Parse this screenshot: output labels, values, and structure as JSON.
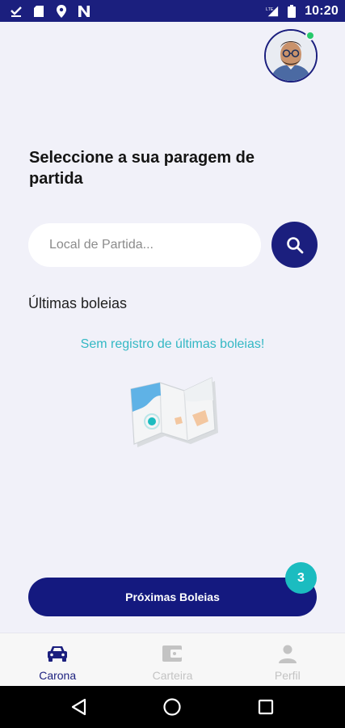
{
  "status_bar": {
    "time": "10:20",
    "icons_left": [
      "check-download-icon",
      "sd-card-icon",
      "location-pin-icon",
      "n-app-icon"
    ],
    "icons_right": [
      "signal-lte-icon",
      "battery-icon"
    ]
  },
  "profile": {
    "avatar_icon": "user-avatar",
    "online": true,
    "online_color": "#27c96b"
  },
  "main": {
    "heading": "Seleccione a sua paragem de partida",
    "search": {
      "placeholder": "Local de Partida...",
      "value": "",
      "button_icon": "search-icon"
    },
    "recent_title": "Últimas boleias",
    "empty_message": "Sem registro de últimas boleias!",
    "illustration_icon": "folded-map-icon"
  },
  "action": {
    "button_label": "Próximas Boleias",
    "badge_count": "3"
  },
  "bottom_nav": {
    "items": [
      {
        "label": "Carona",
        "icon": "car-icon",
        "active": true
      },
      {
        "label": "Carteira",
        "icon": "wallet-icon",
        "active": false
      },
      {
        "label": "Perfil",
        "icon": "person-icon",
        "active": false
      }
    ]
  },
  "system_nav": {
    "buttons": [
      "back-icon",
      "home-icon",
      "recents-icon"
    ]
  },
  "colors": {
    "primary": "#1b1f7e",
    "accent": "#1bbcc0",
    "empty_text": "#33b8c4",
    "background": "#f1f1f9"
  }
}
